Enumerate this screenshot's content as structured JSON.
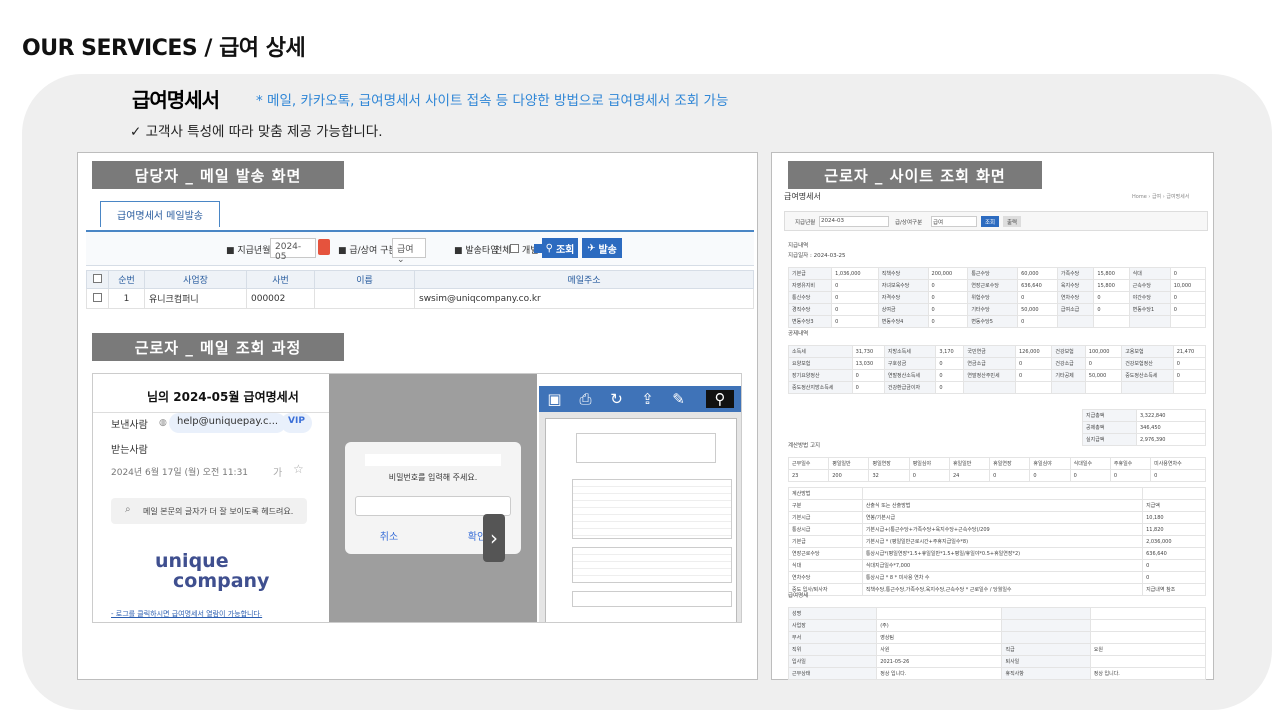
{
  "page_title": "OUR SERVICES / 급여 상세",
  "payslip": {
    "heading": "급여명세서",
    "note": "* 메일, 카카오톡, 급여명세서 사이트 접속 등 다양한 방법으로 급여명세서 조회 가능",
    "check": "✓ 고객사 특성에 따라 맞춤 제공 가능합니다."
  },
  "mail_send": {
    "bar": "담당자 _ 메일 발송 화면",
    "tab": "급여명세서 메일발송",
    "filters": {
      "pay_month_label": "■ 지급년월",
      "pay_month_value": "2024-05",
      "type_label": "■ 급/상여 구분",
      "type_value": "급여",
      "send_type_label": "■ 발송타입",
      "all": "전체",
      "individual": "개별",
      "search": "조회",
      "send": "발송"
    },
    "columns": [
      "",
      "순번",
      "사업장",
      "사번",
      "이름",
      "메일주소"
    ],
    "rows": [
      [
        "",
        "1",
        "유니크컴퍼니",
        "000002",
        "",
        "swsim@uniqcompany.co.kr"
      ]
    ]
  },
  "mail_check": {
    "bar": "근로자 _ 메일 조회 과정",
    "mail_title": "님의 2024-05월 급여명세서",
    "sender_label": "보낸사람",
    "sender": "help@uniquepay.c...",
    "vip": "VIP",
    "receiver_label": "받는사람",
    "date": "2024년 6월 17일 (월) 오전 11:31",
    "font_tip": "메일 본문의 글자가 더 잘 보이도록 헤드려요.",
    "logo_line1": "unique",
    "logo_line2": "company",
    "footer_link": "- 로그를 클릭하시면 급여명세서 열람이 가능합니다.",
    "modal_prompt": "비밀번호를 입력해 주세요.",
    "modal_cancel": "취소",
    "modal_ok": "확인"
  },
  "site_view": {
    "bar": "근로자 _ 사이트 조회 화면",
    "app_title": "급여명세서",
    "breadcrumb": "Home › 급여 › 급여명세서",
    "pay_month_label": "지급년월",
    "pay_month": "2024-03",
    "type_label": "급/상여구분",
    "type_value": "급여",
    "search": "조회",
    "print": "출력",
    "section_pay": "지급내역",
    "pay_date": "지급일자 : 2024-03-25",
    "section_deduct": "공제내역",
    "section_calc": "계산방법 고지",
    "section_info": "급여명세",
    "pay_rows": [
      [
        "기본급",
        "1,036,000",
        "직책수당",
        "200,000",
        "통근수당",
        "60,000",
        "가족수당",
        "15,800",
        "식대",
        "0"
      ],
      [
        "자영유지비",
        "0",
        "자녀보육수당",
        "0",
        "연장근로수당",
        "636,640",
        "육지수당",
        "15,800",
        "근속수당",
        "10,000"
      ],
      [
        "통신수당",
        "0",
        "자격수당",
        "0",
        "위험수당",
        "0",
        "연차수당",
        "0",
        "야간수당",
        "0"
      ],
      [
        "경직수당",
        "0",
        "상여금",
        "0",
        "기타수당",
        "50,000",
        "급여소급",
        "0",
        "변동수당1",
        "0"
      ],
      [
        "변동수당3",
        "0",
        "변동수당4",
        "0",
        "변동수당5",
        "0",
        "",
        "",
        "",
        ""
      ]
    ],
    "deduct_rows": [
      [
        "소득세",
        "31,730",
        "지방소득세",
        "3,170",
        "국민연금",
        "126,000",
        "건강보험",
        "100,000",
        "고용보험",
        "21,470"
      ],
      [
        "요양보험",
        "13,030",
        "구호성금",
        "0",
        "연금소급",
        "0",
        "건강소급",
        "0",
        "건강보험정산",
        "0"
      ],
      [
        "장기요양정산",
        "0",
        "연말정산소득세",
        "0",
        "연말정산주민세",
        "0",
        "기타공제",
        "50,000",
        "중도정산소득세",
        "0"
      ],
      [
        "중도정산지방소득세",
        "0",
        "건강환급금이자",
        "0",
        "",
        "",
        "",
        "",
        "",
        ""
      ]
    ],
    "totals": [
      [
        "지급총액",
        "3,322,840"
      ],
      [
        "공제총액",
        "346,450"
      ],
      [
        "실지급액",
        "2,976,390"
      ]
    ],
    "calc_header": [
      "근무일수",
      "평일일반",
      "평일연장",
      "평일심야",
      "휴일일반",
      "휴일연장",
      "휴일심야",
      "식대일수",
      "주휴일수",
      "미사용연차수"
    ],
    "calc_values": [
      "23",
      "200",
      "32",
      "0",
      "24",
      "0",
      "0",
      "0",
      "0",
      "0"
    ],
    "calc_method_title": "계산방법",
    "calc_columns": [
      "구분",
      "산출식 또는 산출방법",
      "지급액"
    ],
    "calc_rows": [
      [
        "기본시급",
        "연봉/기본시급",
        "10,180"
      ],
      [
        "통상시급",
        "기본시급+(통근수당+가족수당+육지수당+근속수당)/209",
        "11,820"
      ],
      [
        "기본급",
        "기본시급 * (평일일반근로시간+주휴지급일수*8)",
        "2,036,000"
      ],
      [
        "연장근로수당",
        "통상시급*(평일연장*1.5+휴일일반*1.5+평일/휴일야*0.5+휴일연장*2)",
        "636,640"
      ],
      [
        "식대",
        "식대지급일수*7,000",
        "0"
      ],
      [
        "연차수당",
        "통상시급 * 8 * 미사용 연차 수",
        "0"
      ],
      [
        "중도 입사/퇴사자",
        "직책수당,통근수당,가족수당,육지수당,근속수당 * 근로일수 / 당월일수",
        "지급내역 참조"
      ]
    ],
    "info_rows": [
      [
        "성명",
        ""
      ],
      [
        "사업장",
        "(주)"
      ],
      [
        "부서",
        "영상팀"
      ],
      [
        "직위",
        "사원"
      ],
      [
        "입사일",
        "2021-05-26"
      ],
      [
        "근무상태",
        "정상 입니다."
      ]
    ],
    "info_extra": [
      [
        "직급",
        "요원"
      ],
      [
        "퇴사일",
        ""
      ],
      [
        "휴직사항",
        "정상 입니다."
      ]
    ]
  },
  "colors": {
    "accent": "#2c6bc0",
    "note": "#2f86d6",
    "bar": "#7a7a7a"
  }
}
